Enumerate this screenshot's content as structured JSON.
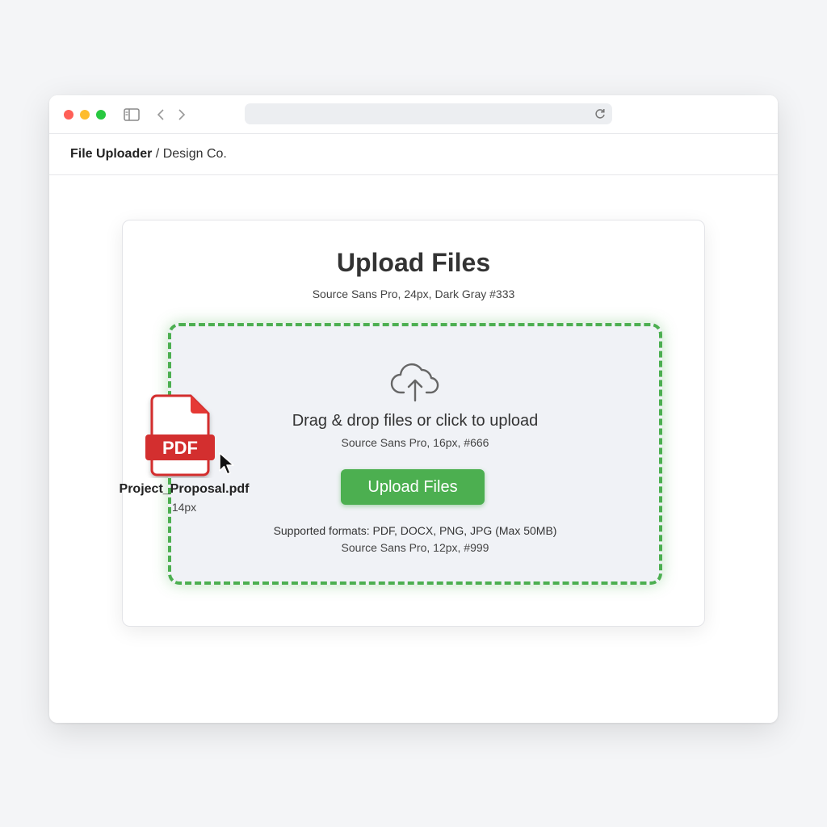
{
  "header": {
    "app_name": "File Uploader",
    "separator": " / ",
    "org_name": "Design Co."
  },
  "card": {
    "title": "Upload Files",
    "title_spec": "Source Sans Pro, 24px, Dark Gray #333"
  },
  "dropzone": {
    "icon": "cloud-upload-icon",
    "instruction": "Drag & drop files or click to upload",
    "instruction_spec": "Source Sans Pro, 16px, #666",
    "button_label": "Upload Files",
    "formats": "Supported formats: PDF, DOCX, PNG, JPG (Max 50MB)",
    "formats_spec": "Source Sans Pro, 12px, #999"
  },
  "dragged_file": {
    "icon_label": "PDF",
    "name": "Project_Proposal.pdf",
    "spec": "14px"
  },
  "colors": {
    "accent": "#4caf50",
    "pdf_red": "#d32f2f",
    "close": "#ff5f57",
    "minimize": "#febc2e",
    "maximize": "#28c840"
  }
}
